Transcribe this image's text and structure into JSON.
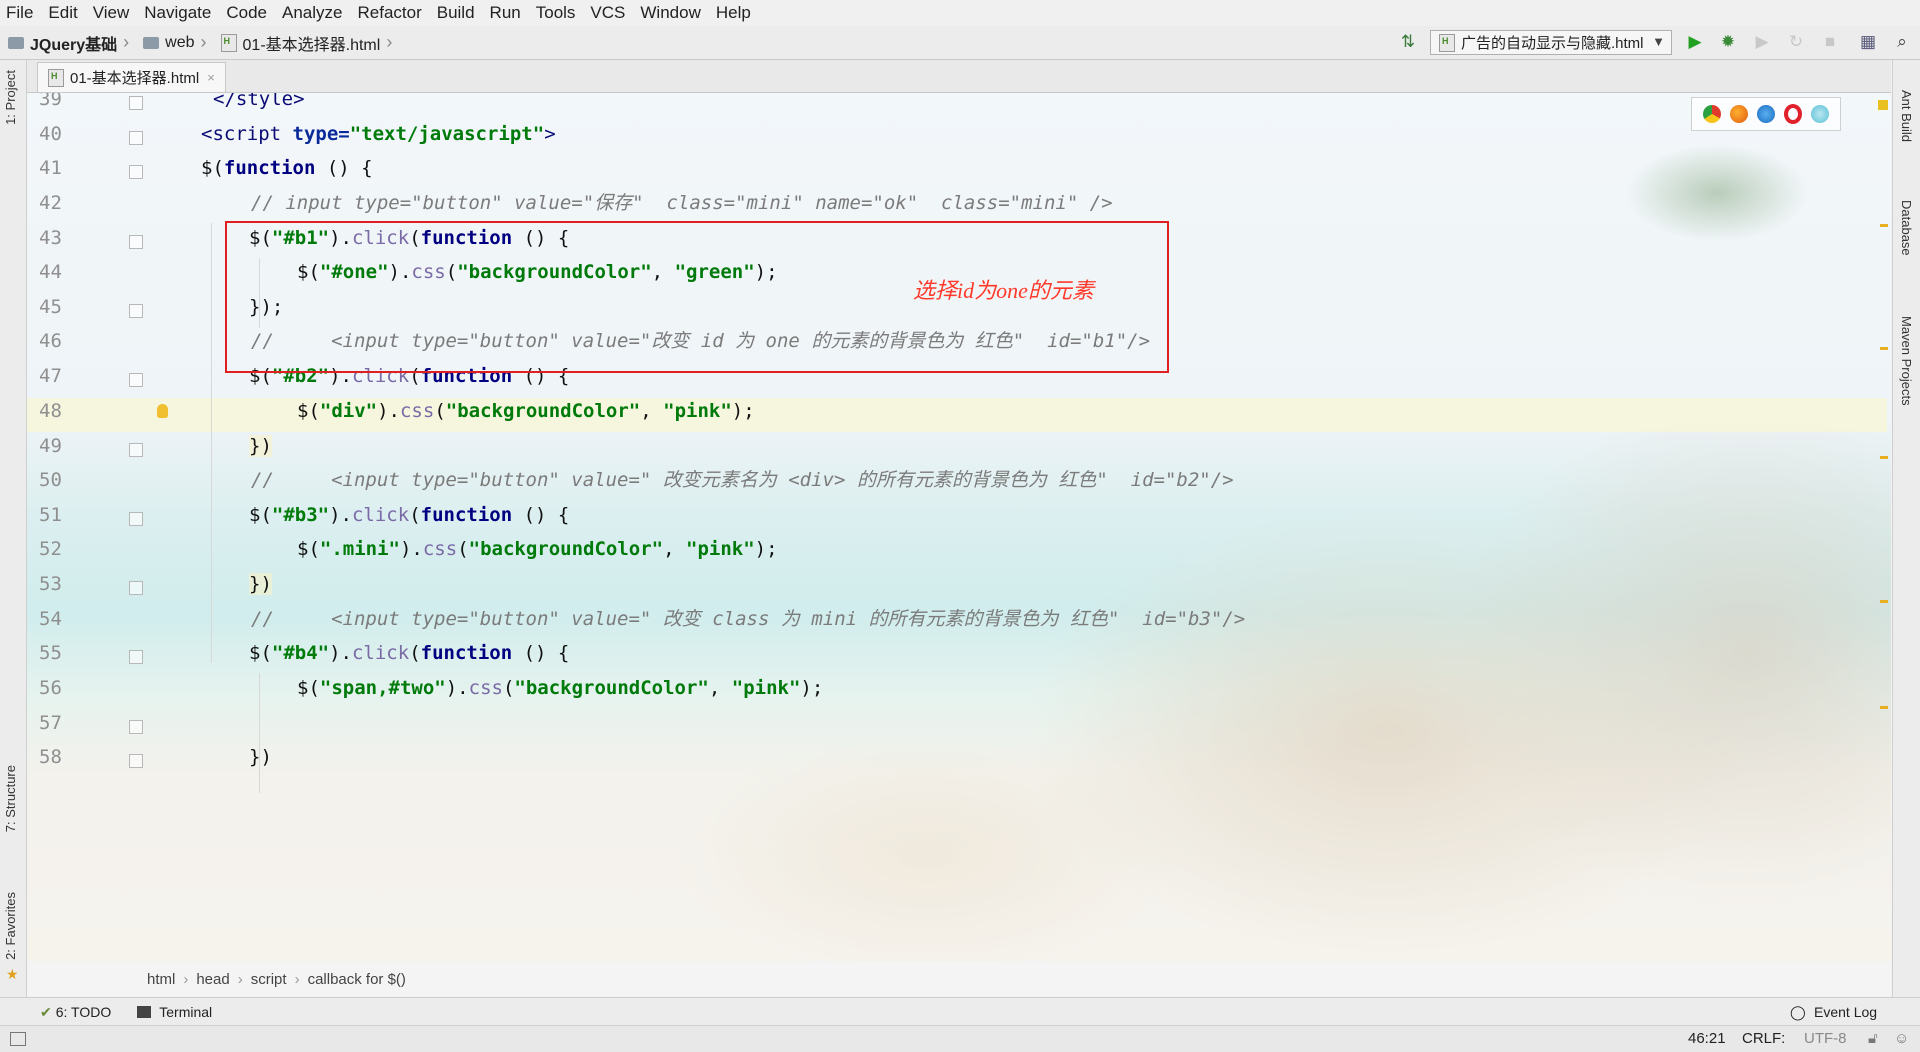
{
  "menu": [
    "File",
    "Edit",
    "View",
    "Navigate",
    "Code",
    "Analyze",
    "Refactor",
    "Build",
    "Run",
    "Tools",
    "VCS",
    "Window",
    "Help"
  ],
  "breadcrumb_nav": {
    "project": "JQuery基础",
    "folder": "web",
    "file": "01-基本选择器.html"
  },
  "run_config": "广告的自动显示与隐藏.html",
  "tab": {
    "label": "01-基本选择器.html",
    "close": "×"
  },
  "left_tools": {
    "project": "1: Project",
    "structure": "7: Structure",
    "favorites": "2: Favorites"
  },
  "right_tools": {
    "ant": "Ant Build",
    "database": "Database",
    "maven": "Maven Projects"
  },
  "lines": [
    "39",
    "40",
    "41",
    "42",
    "43",
    "44",
    "45",
    "46",
    "47",
    "48",
    "49",
    "50",
    "51",
    "52",
    "53",
    "54",
    "55",
    "56",
    "57",
    "58"
  ],
  "code": {
    "l39": {
      "a": "</style>"
    },
    "l40": {
      "a": "<script ",
      "b": "type=",
      "c": "\"text/javascript\"",
      "d": ">"
    },
    "l41": {
      "a": "$(",
      "b": "function",
      "c": " () {"
    },
    "l42": {
      "a": "// input type=\"button\" value=\"保存\"  class=\"mini\" name=\"ok\"  class=\"mini\" />"
    },
    "l43": {
      "a": "$(",
      "b": "\"#b1\"",
      "c": ").",
      "d": "click",
      "e": "(",
      "f": "function",
      "g": " () {"
    },
    "l44": {
      "a": "$(",
      "b": "\"#one\"",
      "c": ").",
      "d": "css",
      "e": "(",
      "f": "\"backgroundColor\"",
      "g": ", ",
      "h": "\"green\"",
      "i": ");"
    },
    "l45": {
      "a": "});"
    },
    "l46": {
      "a": "//     <input type=\"button\" value=\"改变 id 为 one 的元素的背景色为 红色\"  id=\"b1\"/>"
    },
    "l47": {
      "a": "$(",
      "b": "\"#b2\"",
      "c": ").",
      "d": "click",
      "e": "(",
      "f": "function",
      "g": " () {"
    },
    "l48": {
      "a": "$(",
      "b": "\"div\"",
      "c": ").",
      "d": "css",
      "e": "(",
      "f": "\"backgroundColor\"",
      "g": ", ",
      "h": "\"pink\"",
      "i": ");"
    },
    "l49": {
      "a": "})"
    },
    "l50": {
      "a": "//     <input type=\"button\" value=\" 改变元素名为 <div> 的所有元素的背景色为 红色\"  id=\"b2\"/>"
    },
    "l51": {
      "a": "$(",
      "b": "\"#b3\"",
      "c": ").",
      "d": "click",
      "e": "(",
      "f": "function",
      "g": " () {"
    },
    "l52": {
      "a": "$(",
      "b": "\".mini\"",
      "c": ").",
      "d": "css",
      "e": "(",
      "f": "\"backgroundColor\"",
      "g": ", ",
      "h": "\"pink\"",
      "i": ");"
    },
    "l53": {
      "a": "})"
    },
    "l54": {
      "a": "//     <input type=\"button\" value=\" 改变 class 为 mini 的所有元素的背景色为 红色\"  id=\"b3\"/>"
    },
    "l55": {
      "a": "$(",
      "b": "\"#b4\"",
      "c": ").",
      "d": "click",
      "e": "(",
      "f": "function",
      "g": " () {"
    },
    "l56": {
      "a": "$(",
      "b": "\"span,#two\"",
      "c": ").",
      "d": "css",
      "e": "(",
      "f": "\"backgroundColor\"",
      "g": ", ",
      "h": "\"pink\"",
      "i": ");"
    },
    "l57": {
      "a": ""
    },
    "l58": {
      "a": "})"
    }
  },
  "annotation": "选择id为one的元素",
  "editor_breadcrumb": [
    "html",
    "head",
    "script",
    "callback for $()"
  ],
  "bottom_tools": {
    "todo": "6: TODO",
    "terminal": "Terminal",
    "event_log": "Event Log"
  },
  "status": {
    "position": "46:21",
    "line_sep": "CRLF:",
    "encoding": "UTF-8"
  },
  "colors": {
    "annotation_box": "#e02020",
    "string": "#007a0a",
    "keyword": "#000080",
    "comment": "#7b7b7b"
  }
}
